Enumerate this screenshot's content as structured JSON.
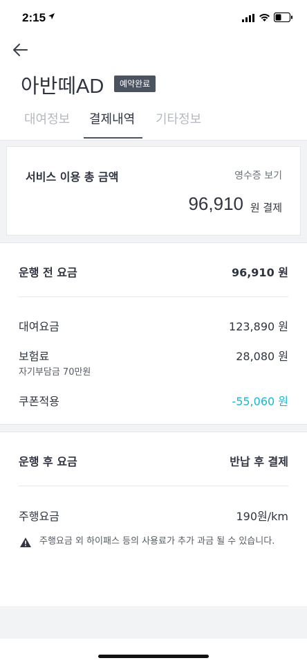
{
  "status_bar": {
    "time": "2:15"
  },
  "header": {
    "title": "아반떼AD",
    "badge": "예약완료",
    "tabs": [
      {
        "label": "대여정보",
        "active": false
      },
      {
        "label": "결제내역",
        "active": true
      },
      {
        "label": "기타정보",
        "active": false
      }
    ]
  },
  "summary": {
    "title": "서비스 이용 총 금액",
    "receipt_link": "영수증 보기",
    "total_amount": "96,910",
    "total_suffix": "원 결제"
  },
  "pre_drive": {
    "title": "운행 전 요금",
    "total": "96,910 원",
    "items": [
      {
        "label": "대여요금",
        "value": "123,890 원"
      },
      {
        "label": "보험료",
        "sub": "자기부담금 70만원",
        "value": "28,080 원"
      },
      {
        "label": "쿠폰적용",
        "value": "-55,060 원"
      }
    ]
  },
  "post_drive": {
    "title": "운행 후 요금",
    "status": "반납 후 결제",
    "items": [
      {
        "label": "주행요금",
        "value": "190원/km"
      }
    ],
    "notice": "주행요금 외 하이패스 등의 사용료가 추가 과금 될 수 있습니다."
  },
  "colors": {
    "accent": "#18b8cf",
    "badge_bg": "#4b5361",
    "text": "#2f3440"
  },
  "icons": [
    "location-arrow-icon",
    "signal-icon",
    "wifi-icon",
    "battery-icon",
    "back-arrow-icon",
    "warning-icon"
  ]
}
